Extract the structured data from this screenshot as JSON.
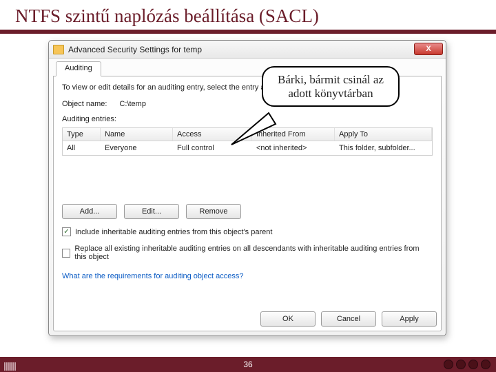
{
  "slide": {
    "title": "NTFS szintű naplózás beállítása (SACL)",
    "page_number": "36"
  },
  "dialog": {
    "title": "Advanced Security Settings for temp",
    "tab_label": "Auditing",
    "intro": "To view or edit details for an auditing entry, select the entry and then click Edit.",
    "object_label": "Object name:",
    "object_value": "C:\\temp",
    "entries_label": "Auditing entries:",
    "columns": {
      "type": "Type",
      "name": "Name",
      "access": "Access",
      "inherited": "Inherited From",
      "apply": "Apply To"
    },
    "rows": [
      {
        "type": "All",
        "name": "Everyone",
        "access": "Full control",
        "inherited": "<not inherited>",
        "apply": "This folder, subfolder..."
      }
    ],
    "buttons": {
      "add": "Add...",
      "edit": "Edit...",
      "remove": "Remove"
    },
    "check1": {
      "checked": true,
      "label": "Include inheritable auditing entries from this object's parent"
    },
    "check2": {
      "checked": false,
      "label": "Replace all existing inheritable auditing entries on all descendants with inheritable auditing entries from this object"
    },
    "help_link": "What are the requirements for auditing object access?",
    "dlg_buttons": {
      "ok": "OK",
      "cancel": "Cancel",
      "apply": "Apply"
    },
    "close_glyph": "X"
  },
  "callout": {
    "text": "Bárki, bármit csinál az adott könyvtárban"
  }
}
